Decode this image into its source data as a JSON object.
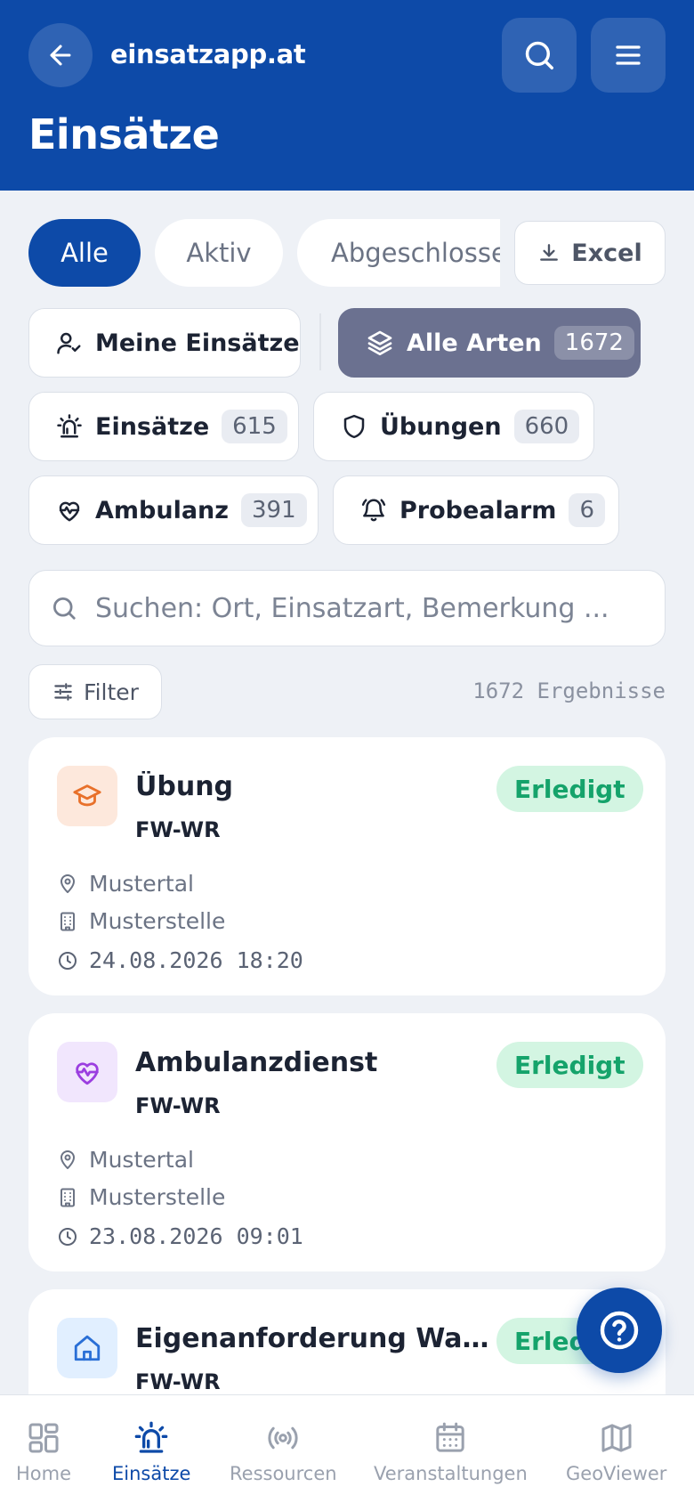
{
  "header": {
    "site_name": "einsatzapp.at",
    "page_title": "Einsätze",
    "color": "#0d4aa8"
  },
  "status_tabs": [
    {
      "label": "Alle",
      "selected": true
    },
    {
      "label": "Aktiv",
      "selected": false
    },
    {
      "label": "Abgeschlossen",
      "selected": false
    }
  ],
  "excel_label": "Excel",
  "chips": {
    "meine": {
      "label": "Meine Einsätze"
    },
    "alle_arten": {
      "label": "Alle Arten",
      "count": "1672",
      "selected": true
    },
    "einsaetze": {
      "label": "Einsätze",
      "count": "615"
    },
    "uebungen": {
      "label": "Übungen",
      "count": "660"
    },
    "ambulanz": {
      "label": "Ambulanz",
      "count": "391"
    },
    "probealarm": {
      "label": "Probealarm",
      "count": "6"
    }
  },
  "search": {
    "placeholder": "Suchen: Ort, Einsatzart, Bemerkung ..."
  },
  "filter_label": "Filter",
  "results_text": "1672 Ergebnisse",
  "cards": [
    {
      "type": "Übung",
      "org": "FW-WR",
      "status": "Erledigt",
      "location": "Mustertal",
      "site": "Musterstelle",
      "datetime": "24.08.2026 18:20",
      "icon": "graduation-cap-icon"
    },
    {
      "type": "Ambulanzdienst",
      "org": "FW-WR",
      "status": "Erledigt",
      "location": "Mustertal",
      "site": "Musterstelle",
      "datetime": "23.08.2026 09:01",
      "icon": "heart-pulse-icon"
    },
    {
      "type": "Eigenanforderung Wasse...",
      "org": "FW-WR",
      "status": "Erledigt",
      "icon": "home-icon"
    }
  ],
  "nav": [
    {
      "label": "Home",
      "active": false
    },
    {
      "label": "Einsätze",
      "active": true
    },
    {
      "label": "Ressourcen",
      "active": false
    },
    {
      "label": "Veranstaltungen",
      "active": false
    },
    {
      "label": "GeoViewer",
      "active": false
    }
  ],
  "colors": {
    "primary": "#0d4aa8",
    "success_bg": "#d3f5e2",
    "success_text": "#15a36b",
    "chip_selected": "#6b7190"
  }
}
